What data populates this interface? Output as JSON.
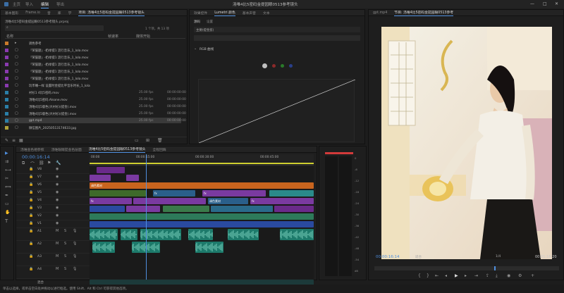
{
  "app": {
    "nav": [
      "主页",
      "导入",
      "编辑",
      "导出"
    ],
    "active_nav": "编辑",
    "window_title": "汤唯4比5密码金提园眼0513参考镜头",
    "window_buttons": [
      "—",
      "□",
      "✕"
    ]
  },
  "project_panel": {
    "tabs": [
      "基本图形",
      "Frame.io",
      "音",
      "库",
      "学",
      "项目: 汤唯4比5密码金提园眼0513参考镜头"
    ],
    "path": "汤唯4比5密码金提园眼0513参考镜头.prproj",
    "item_count": "1 个项，共 13 项",
    "columns": {
      "name": "名称",
      "framerate": "帧速率",
      "media_start": "媒体开始"
    },
    "items": [
      {
        "name": "调色参考",
        "fps": "",
        "tc": "",
        "color": "#c97a2b"
      },
      {
        "name": "「荣誉题」-奶绿提1 流行音乐_1_lola.mov",
        "fps": "",
        "tc": "",
        "color": "#8a3ab0"
      },
      {
        "name": "「荣誉题」-奶绿提1 流行音乐_1_lola.mov",
        "fps": "",
        "tc": "",
        "color": "#8a3ab0"
      },
      {
        "name": "「荣誉题」-奶绿提1 流行音乐_1_lola.mov",
        "fps": "",
        "tc": "",
        "color": "#8a3ab0"
      },
      {
        "name": "「荣誉题」-奶绿提1 流行音乐_1_lola.mov",
        "fps": "",
        "tc": "",
        "color": "#8a3ab0"
      },
      {
        "name": "「荣誉题」-奶绿提1 流行音乐_1_lola.mov",
        "fps": "",
        "tc": "",
        "color": "#8a3ab0"
      },
      {
        "name": "玩币嘴一样 设置时金提比平音乐时长_1_lola",
        "fps": "",
        "tc": "",
        "color": "#8a3ab0"
      },
      {
        "name": "衬衫1 4比5密码.mov",
        "fps": "25.00 fps",
        "tc": "00:00:00:00",
        "color": "#2a7fa8"
      },
      {
        "name": "汤唯4比5密码.Alsone.mov",
        "fps": "25.00 fps",
        "tc": "00:00:00:00",
        "color": "#2a7fa8"
      },
      {
        "name": "汤唯4比5版色(大衬衫)(提金).mov",
        "fps": "25.00 fps",
        "tc": "00:00:00:00",
        "color": "#2a7fa8"
      },
      {
        "name": "汤唯4比5版色(大衬衫)(提金).mov",
        "fps": "25.00 fps",
        "tc": "00:00:00:00",
        "color": "#2a7fa8"
      },
      {
        "name": "gpt.mp4",
        "fps": "25.00 fps",
        "tc": "00:00:00:00",
        "color": "#2a7fa8"
      },
      {
        "name": "微信图片_20250513174633.jpg",
        "fps": "",
        "tc": "",
        "color": "#b0a23a"
      }
    ]
  },
  "lumetri_panel": {
    "tabs": [
      "效果控件",
      "Lumetri 颜色",
      "基本声音",
      "文本"
    ],
    "subtabs": [
      "源码",
      "设置"
    ],
    "dropdown": "主要(提金剪)",
    "section": "RGB 曲线"
  },
  "program_monitor": {
    "tabs": [
      "gpt.mp4",
      "节目: 汤唯4比5密码金提园眼0513参考"
    ],
    "timecode_left": "00:00:16:14",
    "fit_label": "适合",
    "ratio_label": "1/4",
    "timecode_right": "00:01:16:20"
  },
  "timeline": {
    "tabs": [
      "汤唯金色相参照",
      "汤唯眼睛提金色层面",
      "汤唯4比5密码金提园眼0513参考镜头",
      "全程回眸"
    ],
    "timecode": "00:00:16:14",
    "ruler_labels": [
      "00:00",
      "00:00:15:00",
      "00:00:30:00",
      "00:00:45:00"
    ],
    "video_tracks": [
      "V8",
      "V7",
      "V6",
      "V5",
      "V4",
      "V3",
      "V2",
      "V1"
    ],
    "audio_tracks": [
      "A1",
      "A2",
      "A3",
      "A4"
    ],
    "audio_mix_label": "混合",
    "clip_labels": [
      "调色素材",
      "fx",
      "fx",
      "fx",
      "调色素材",
      "fx"
    ]
  },
  "status_bar": {
    "text": "单击以选择，或单击空白处并拖动以进行框选。使用 Shift、Alt 和 Ctrl 可获得其他选项。"
  },
  "colors": {
    "accent": "#4f8fdf",
    "timecode": "#4f8fdf",
    "adjustment": "#e07a2a",
    "audio": "#1d7a6b"
  }
}
